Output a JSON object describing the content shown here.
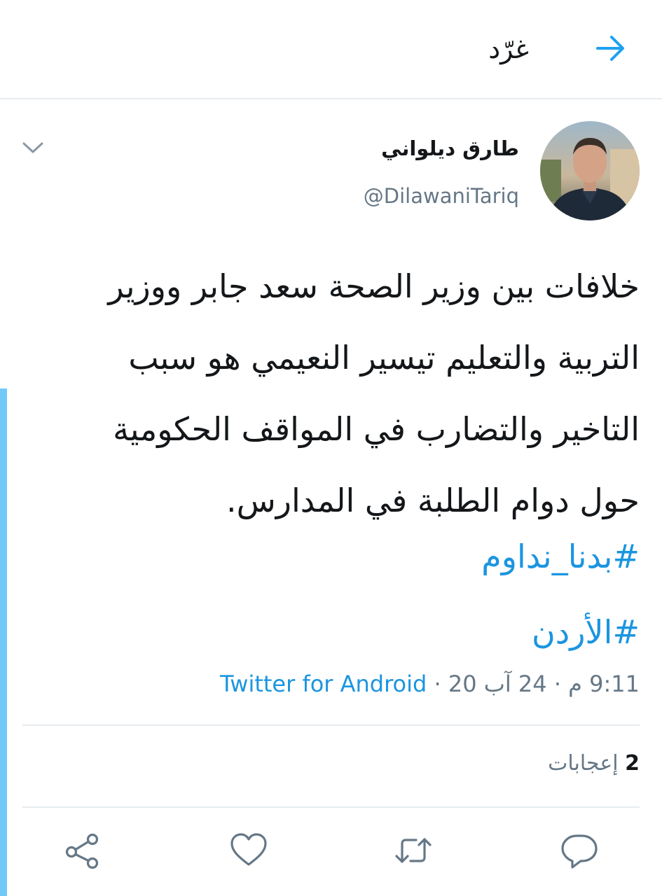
{
  "header": {
    "title": "غرّد",
    "back_icon": "arrow-right-icon"
  },
  "tweet": {
    "display_name": "طارق ديلواني",
    "handle": "@DilawaniTariq",
    "menu_icon": "chevron-down-icon",
    "text_lines": [
      "خلافات بين وزير الصحة سعد جابر ووزير",
      "التربية والتعليم تيسير النعيمي هو سبب",
      "التاخير والتضارب في المواقف الحكومية",
      "حول دوام الطلبة في المدارس."
    ],
    "hashtags": [
      "#بدنا_نداوم",
      "#الأردن"
    ],
    "timestamp": "9:11 م · 24 آب 20",
    "separator": " · ",
    "source": "Twitter for Android",
    "likes_count": "2",
    "likes_label": "إعجابات"
  },
  "actions": {
    "reply": "reply-icon",
    "retweet": "retweet-icon",
    "like": "heart-icon",
    "share": "share-icon"
  },
  "colors": {
    "link": "#1b95e0",
    "muted": "#657786",
    "text": "#14171a",
    "accent_bar": "#71c9f8",
    "divider": "#e6ecf0"
  }
}
